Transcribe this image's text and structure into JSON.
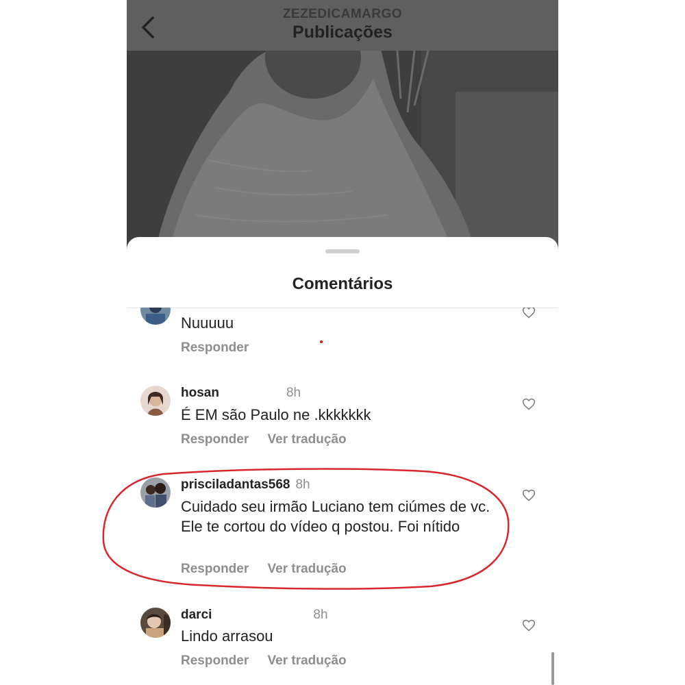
{
  "header": {
    "username": "ZEZEDICAMARGO",
    "title": "Publicações"
  },
  "sheet": {
    "title": "Comentários"
  },
  "comments": [
    {
      "username": "",
      "time": "",
      "text": "Nuuuuu",
      "reply_label": "Responder",
      "translate_label": ""
    },
    {
      "username": "hosan",
      "time": "8h",
      "text": "É EM são Paulo ne .kkkkkkk",
      "reply_label": "Responder",
      "translate_label": "Ver tradução"
    },
    {
      "username": "prisciladantas568",
      "time": "8h",
      "text": "Cuidado seu irmão Luciano tem ciúmes de vc. Ele te cortou do vídeo q postou. Foi nítido",
      "reply_label": "Responder",
      "translate_label": "Ver tradução"
    },
    {
      "username": "darci",
      "time": "8h",
      "text": "Lindo arrasou",
      "reply_label": "Responder",
      "translate_label": "Ver tradução"
    }
  ],
  "colors": {
    "header_bg": "#5f5f5f",
    "highlight_ring": "#d8262c",
    "secondary_text": "#8e8e8e"
  },
  "icons": [
    "back-chevron-icon",
    "heart-outline-icon"
  ]
}
